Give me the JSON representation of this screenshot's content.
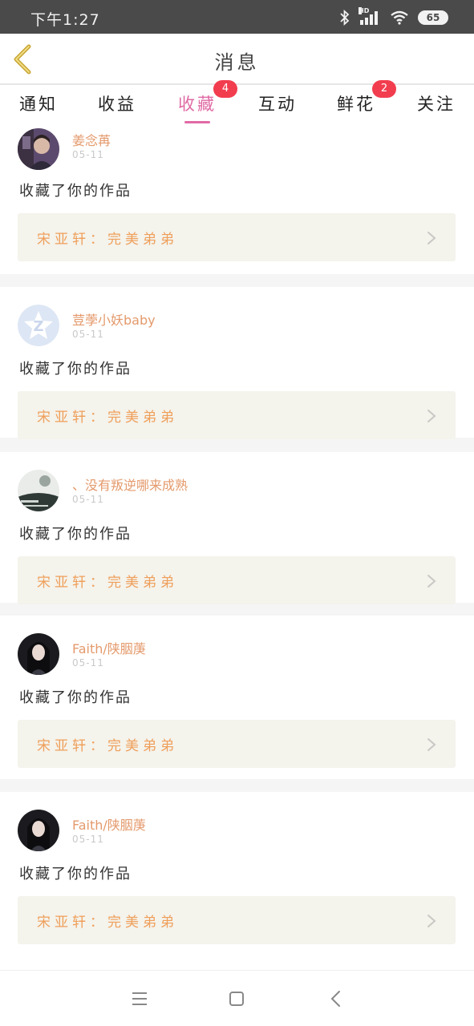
{
  "status_bar": {
    "time": "下午1:27",
    "hd_label": "HD",
    "battery": "65",
    "icons": [
      "bluetooth-icon",
      "signal-icon",
      "wifi-icon",
      "battery-icon"
    ]
  },
  "header": {
    "title": "消息",
    "back_icon": "back-chevron-icon"
  },
  "tabs": [
    {
      "label": "通知",
      "badge": null,
      "active": false
    },
    {
      "label": "收益",
      "badge": null,
      "active": false
    },
    {
      "label": "收藏",
      "badge": "4",
      "active": true
    },
    {
      "label": "互动",
      "badge": null,
      "active": false
    },
    {
      "label": "鲜花",
      "badge": "2",
      "active": false
    },
    {
      "label": "关注",
      "badge": null,
      "active": false
    }
  ],
  "items": [
    {
      "user": "姜念苒",
      "date": "05-11",
      "action": "收藏了你的作品",
      "work": "宋亚轩：完美弟弟"
    },
    {
      "user": "荳荸小妖baby",
      "date": "05-11",
      "action": "收藏了你的作品",
      "work": "宋亚轩：完美弟弟"
    },
    {
      "user": "、没有叛逆哪来成熟",
      "date": "05-11",
      "action": "收藏了你的作品",
      "work": "宋亚轩：完美弟弟"
    },
    {
      "user": "Faith/陕胭菮",
      "date": "05-11",
      "action": "收藏了你的作品",
      "work": "宋亚轩：完美弟弟"
    },
    {
      "user": "Faith/陕胭菮",
      "date": "05-11",
      "action": "收藏了你的作品",
      "work": "宋亚轩：完美弟弟"
    }
  ],
  "colors": {
    "accent_tab": "#e06aa4",
    "username": "#e49a6c",
    "work_title": "#ef9f5a",
    "badge": "#f23d4f",
    "back_icon": "#c9a83a"
  },
  "nav": {
    "icons": [
      "menu-icon",
      "home-square-icon",
      "back-icon"
    ]
  }
}
